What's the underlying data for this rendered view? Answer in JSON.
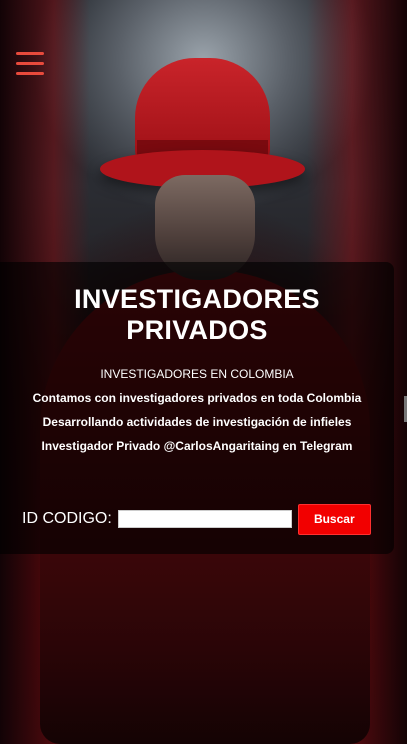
{
  "hero": {
    "title": "INVESTIGADORES PRIVADOS",
    "lines": [
      "INVESTIGADORES EN COLOMBIA",
      "Contamos con investigadores privados en toda Colombia",
      "Desarrollando actividades de investigación de infieles",
      "Investigador Privado @CarlosAngaritaing en Telegram"
    ]
  },
  "search": {
    "label": "ID CODIGO:",
    "value": "",
    "button_label": "Buscar"
  },
  "icons": {
    "menu": "hamburger-menu-icon"
  },
  "colors": {
    "accent": "#f20000",
    "menu": "#e84a3c"
  }
}
